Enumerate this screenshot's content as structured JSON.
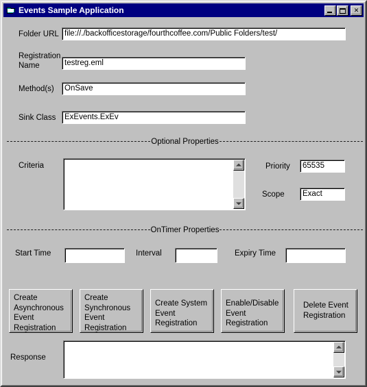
{
  "window": {
    "title": "Events Sample Application",
    "icon": "folder-icon",
    "controls": {
      "minimize": "minimize-icon",
      "maximize": "maximize-icon",
      "close": "✕"
    },
    "colors": {
      "titlebar": "#000080",
      "face": "#c0c0c0",
      "field": "#ffffff",
      "text": "#000000"
    }
  },
  "form": {
    "folder_url": {
      "label": "Folder URL",
      "value": "file://./backofficestorage/fourthcoffee.com/Public Folders/test/",
      "placeholder": ""
    },
    "registration_name": {
      "label": "Registration\nName",
      "value": "testreg.eml",
      "placeholder": ""
    },
    "methods": {
      "label": "Method(s)",
      "value": "OnSave",
      "placeholder": ""
    },
    "sink_class": {
      "label": "Sink Class",
      "value": "ExEvents.ExEv",
      "placeholder": ""
    }
  },
  "optional_properties": {
    "section_title": "Optional Properties",
    "criteria": {
      "label": "Criteria",
      "value": "",
      "placeholder": ""
    },
    "priority": {
      "label": "Priority",
      "value": "65535",
      "placeholder": ""
    },
    "scope": {
      "label": "Scope",
      "value": "Exact",
      "placeholder": ""
    }
  },
  "ontimer_properties": {
    "section_title": "OnTimer Properties",
    "start_time": {
      "label": "Start Time",
      "value": "",
      "placeholder": ""
    },
    "interval": {
      "label": "Interval",
      "value": "",
      "placeholder": ""
    },
    "expiry_time": {
      "label": "Expiry Time",
      "value": "",
      "placeholder": ""
    }
  },
  "buttons": [
    {
      "label": "Create\nAsynchronous\nEvent\nRegistration"
    },
    {
      "label": "Create\nSynchronous\nEvent\nRegistration"
    },
    {
      "label": "Create System\nEvent\nRegistration"
    },
    {
      "label": "Enable/Disable\nEvent\nRegistration"
    },
    {
      "label": "Delete Event\nRegistration"
    }
  ],
  "response": {
    "label": "Response",
    "value": "",
    "placeholder": ""
  }
}
